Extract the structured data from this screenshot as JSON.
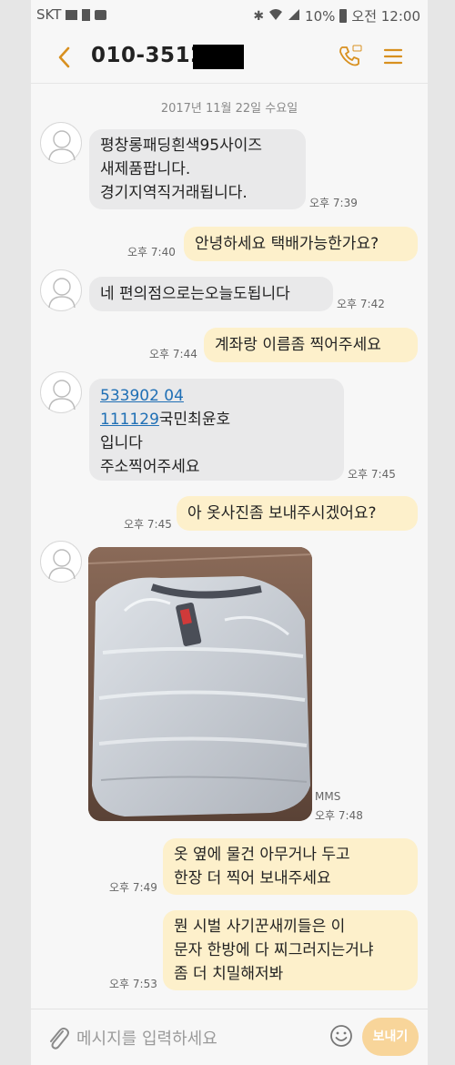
{
  "status_bar": {
    "carrier": "SKT",
    "battery": "10%",
    "time": "오전 12:00"
  },
  "header": {
    "contact": "010-3512-"
  },
  "date_label": "2017년 11월 22일 수요일",
  "messages": [
    {
      "dir": "in",
      "lines": [
        "평창롱패딩흰색95사이즈",
        "새제품팝니다.",
        "경기지역직거래됩니다."
      ],
      "time": "오후 7:39"
    },
    {
      "dir": "out",
      "lines": [
        "안녕하세요 택배가능한가요?"
      ],
      "time": "오후 7:40"
    },
    {
      "dir": "in",
      "lines": [
        "네 편의점으로는오늘도됩니다"
      ],
      "time": "오후 7:42"
    },
    {
      "dir": "out",
      "lines": [
        "계좌랑 이름좀 찍어주세요"
      ],
      "time": "오후 7:44"
    },
    {
      "dir": "in",
      "link1": "533902 04",
      "link2": "111129",
      "after_link2": "국민최윤호",
      "lines": [
        "입니다",
        "주소찍어주세요"
      ],
      "time": "오후 7:45"
    },
    {
      "dir": "out",
      "lines": [
        "아 옷사진좀 보내주시겠어요?"
      ],
      "time": "오후 7:45"
    },
    {
      "dir": "in",
      "type": "mms",
      "mms_label": "MMS",
      "time": "오후 7:48"
    },
    {
      "dir": "out",
      "lines": [
        "옷 옆에 물건 아무거나 두고",
        "한장 더 찍어 보내주세요"
      ],
      "time": "오후 7:49"
    },
    {
      "dir": "out",
      "lines": [
        "뭔 시벌 사기꾼새끼들은 이",
        "문자 한방에 다 찌그러지는거냐",
        "좀 더 치밀해저봐"
      ],
      "time": "오후 7:53"
    }
  ],
  "composer": {
    "placeholder": "메시지를 입력하세요",
    "send_label": "보내기"
  }
}
